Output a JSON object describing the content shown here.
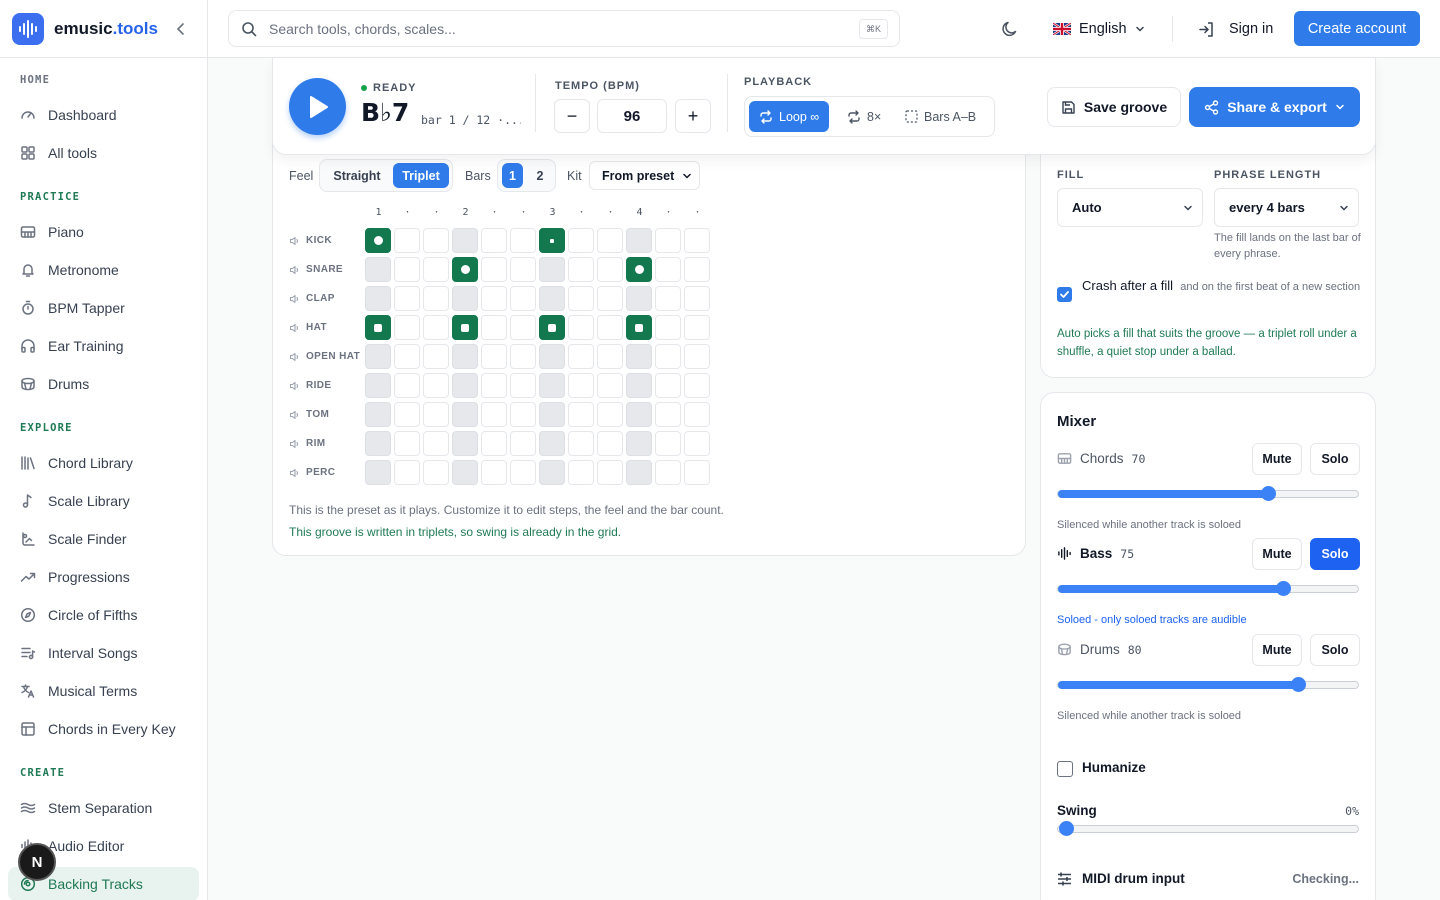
{
  "brand": {
    "name_plain": "emusic",
    "name_accent": ".tools"
  },
  "sidebar": {
    "sections": [
      {
        "label": "HOME",
        "items": [
          {
            "label": "Dashboard",
            "icon": "gauge-icon"
          },
          {
            "label": "All tools",
            "icon": "grid-icon"
          }
        ]
      },
      {
        "label": "PRACTICE",
        "items": [
          {
            "label": "Piano",
            "icon": "piano-icon"
          },
          {
            "label": "Metronome",
            "icon": "bell-icon"
          },
          {
            "label": "BPM Tapper",
            "icon": "timer-icon"
          },
          {
            "label": "Ear Training",
            "icon": "headphones-icon"
          },
          {
            "label": "Drums",
            "icon": "drum-icon"
          }
        ]
      },
      {
        "label": "EXPLORE",
        "items": [
          {
            "label": "Chord Library",
            "icon": "library-icon"
          },
          {
            "label": "Scale Library",
            "icon": "note-icon"
          },
          {
            "label": "Scale Finder",
            "icon": "finder-icon"
          },
          {
            "label": "Progressions",
            "icon": "trend-icon"
          },
          {
            "label": "Circle of Fifths",
            "icon": "compass-icon"
          },
          {
            "label": "Interval Songs",
            "icon": "list-music-icon"
          },
          {
            "label": "Musical Terms",
            "icon": "languages-icon"
          },
          {
            "label": "Chords in Every Key",
            "icon": "table-icon"
          }
        ]
      },
      {
        "label": "CREATE",
        "items": [
          {
            "label": "Stem Separation",
            "icon": "waves-icon"
          },
          {
            "label": "Audio Editor",
            "icon": "audio-lines-icon"
          },
          {
            "label": "Backing Tracks",
            "icon": "disc-icon",
            "active": true
          }
        ]
      }
    ],
    "badge": "N"
  },
  "topbar": {
    "search_placeholder": "Search tools, chords, scales...",
    "shortcut": "⌘K",
    "language": "English",
    "sign_in": "Sign in",
    "create_account": "Create account"
  },
  "player": {
    "status": "READY",
    "chord": "B♭7",
    "bar_info": "bar 1 / 12 ·...",
    "tempo_label": "TEMPO (BPM)",
    "tempo_minus": "−",
    "tempo_plus": "+",
    "tempo": "96",
    "playback_label": "PLAYBACK",
    "loop": "Loop ∞",
    "repeat": "8×",
    "bars_ab": "Bars A–B",
    "save": "Save groove",
    "share": "Share & export"
  },
  "groove": {
    "feel_label": "Feel",
    "feel_options": [
      "Straight",
      "Triplet"
    ],
    "feel_selected": "Triplet",
    "bars_label": "Bars",
    "bars_options": [
      "1",
      "2"
    ],
    "bars_selected": "1",
    "kit_label": "Kit",
    "kit_value": "From preset",
    "beat_markers": [
      "1",
      "·",
      "·",
      "2",
      "·",
      "·",
      "3",
      "·",
      "·",
      "4",
      "·",
      "·"
    ],
    "rows": [
      {
        "label": "KICK",
        "steps": [
          1,
          0,
          0,
          0,
          0,
          0,
          1,
          0,
          0,
          0,
          0,
          0
        ],
        "marks": [
          "circle",
          null,
          null,
          null,
          null,
          null,
          "small",
          null,
          null,
          null,
          null,
          null
        ]
      },
      {
        "label": "SNARE",
        "steps": [
          0,
          0,
          0,
          1,
          0,
          0,
          0,
          0,
          0,
          1,
          0,
          0
        ],
        "marks": [
          null,
          null,
          null,
          "circle",
          null,
          null,
          null,
          null,
          null,
          "circle",
          null,
          null
        ]
      },
      {
        "label": "CLAP",
        "steps": [
          0,
          0,
          0,
          0,
          0,
          0,
          0,
          0,
          0,
          0,
          0,
          0
        ]
      },
      {
        "label": "HAT",
        "steps": [
          1,
          0,
          0,
          1,
          0,
          0,
          1,
          0,
          0,
          1,
          0,
          0
        ],
        "marks": [
          "square",
          null,
          null,
          "square",
          null,
          null,
          "square",
          null,
          null,
          "square",
          null,
          null
        ]
      },
      {
        "label": "OPEN HAT",
        "steps": [
          0,
          0,
          0,
          0,
          0,
          0,
          0,
          0,
          0,
          0,
          0,
          0
        ]
      },
      {
        "label": "RIDE",
        "steps": [
          0,
          0,
          0,
          0,
          0,
          0,
          0,
          0,
          0,
          0,
          0,
          0
        ]
      },
      {
        "label": "TOM",
        "steps": [
          0,
          0,
          0,
          0,
          0,
          0,
          0,
          0,
          0,
          0,
          0,
          0
        ]
      },
      {
        "label": "RIM",
        "steps": [
          0,
          0,
          0,
          0,
          0,
          0,
          0,
          0,
          0,
          0,
          0,
          0
        ]
      },
      {
        "label": "PERC",
        "steps": [
          0,
          0,
          0,
          0,
          0,
          0,
          0,
          0,
          0,
          0,
          0,
          0
        ]
      }
    ],
    "note": "This is the preset as it plays. Customize it to edit steps, the feel and the bar count.",
    "triplet_note": "This groove is written in triplets, so swing is already in the grid."
  },
  "fill": {
    "fill_label": "FILL",
    "fill_value": "Auto",
    "phrase_label": "PHRASE LENGTH",
    "phrase_value": "every 4 bars",
    "phrase_hint": "The fill lands on the last bar of every phrase.",
    "crash_label": "Crash after a fill",
    "crash_sub": "and on the first beat of a new section",
    "crash_checked": true,
    "auto_note": "Auto picks a fill that suits the groove — a triplet roll under a shuffle, a quiet stop under a ballad."
  },
  "mixer": {
    "title": "Mixer",
    "mute_label": "Mute",
    "solo_label": "Solo",
    "tracks": [
      {
        "name": "Chords",
        "value": "70",
        "level": 70,
        "solo": false,
        "active": false,
        "note": "Silenced while another track is soloed",
        "icon": "piano-icon"
      },
      {
        "name": "Bass",
        "value": "75",
        "level": 75,
        "solo": true,
        "active": true,
        "note": "Soloed - only soloed tracks are audible",
        "icon": "audio-lines-icon"
      },
      {
        "name": "Drums",
        "value": "80",
        "level": 80,
        "solo": false,
        "active": false,
        "note": "Silenced while another track is soloed",
        "icon": "drum-icon"
      }
    ],
    "humanize": "Humanize",
    "humanize_checked": false,
    "swing_label": "Swing",
    "swing_value": "0%",
    "swing_level": 0,
    "midi_label": "MIDI drum input",
    "midi_status": "Checking..."
  },
  "colors": {
    "accent": "#2f7bea",
    "green": "#14784f",
    "solo_blue": "#1d62f0"
  }
}
